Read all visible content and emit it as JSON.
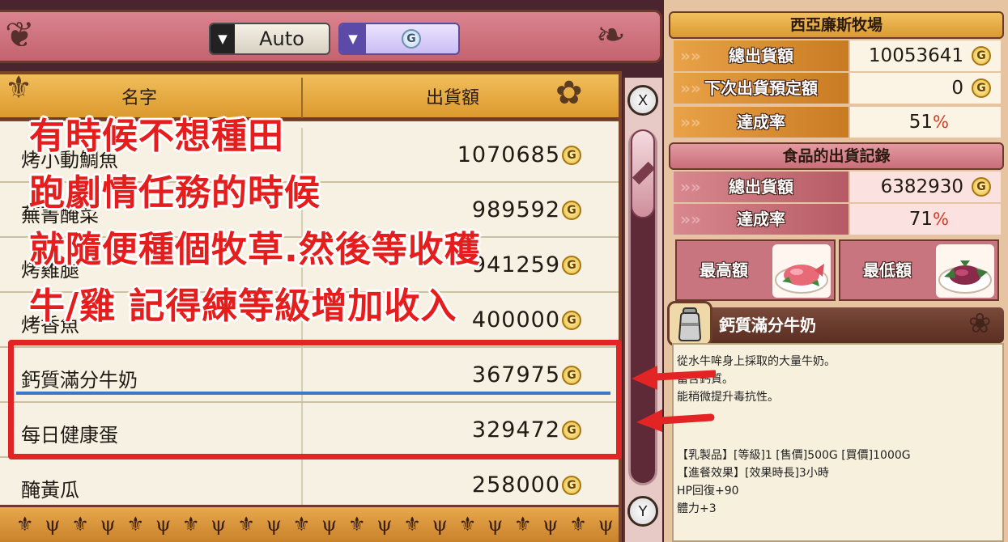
{
  "sort": {
    "value": "Auto"
  },
  "filter": {
    "value": "",
    "icon": "g-coin-icon"
  },
  "list": {
    "headers": {
      "name": "名字",
      "amount": "出貨額"
    },
    "rows": [
      {
        "name": "烤小動鯛魚",
        "amount": "1070685"
      },
      {
        "name": "蕪菁醃菜",
        "amount": "989592"
      },
      {
        "name": "烤雞腿",
        "amount": "941259"
      },
      {
        "name": "烤香魚",
        "amount": "400000"
      },
      {
        "name": "鈣質滿分牛奶",
        "amount": "367975"
      },
      {
        "name": "每日健康蛋",
        "amount": "329472"
      },
      {
        "name": "醃黃瓜",
        "amount": "258000"
      }
    ],
    "currency": "G",
    "scroll_up_button": "X",
    "scroll_down_button": "Y"
  },
  "farm": {
    "title": "西亞廉斯牧場",
    "total_label": "總出貨額",
    "total_value": "10053641",
    "next_label": "下次出貨預定額",
    "next_value": "0",
    "rate_label": "達成率",
    "rate_value": "51",
    "pct": "%"
  },
  "food": {
    "title": "食品的出貨記錄",
    "total_label": "總出貨額",
    "total_value": "6382930",
    "rate_label": "達成率",
    "rate_value": "71",
    "pct": "%",
    "highest_label": "最高額",
    "lowest_label": "最低額"
  },
  "item": {
    "name": "鈣質滿分牛奶",
    "desc": [
      "從水牛哞身上採取的大量牛奶。",
      "富含鈣質。",
      "能稍微提升毒抗性。"
    ],
    "stats": [
      "【乳製品】[等級]1 [售價]500G [買價]1000G",
      "【進餐效果】[效果時長]3小時",
      "HP回復+90",
      "體力+3"
    ]
  },
  "annotation": {
    "lines": [
      "有時候不想種田",
      "跑劇情任務的時候",
      "就隨便種個牧草.然後等收穫",
      "牛/雞 記得練等級增加收入"
    ],
    "color": "#e51d1d"
  }
}
